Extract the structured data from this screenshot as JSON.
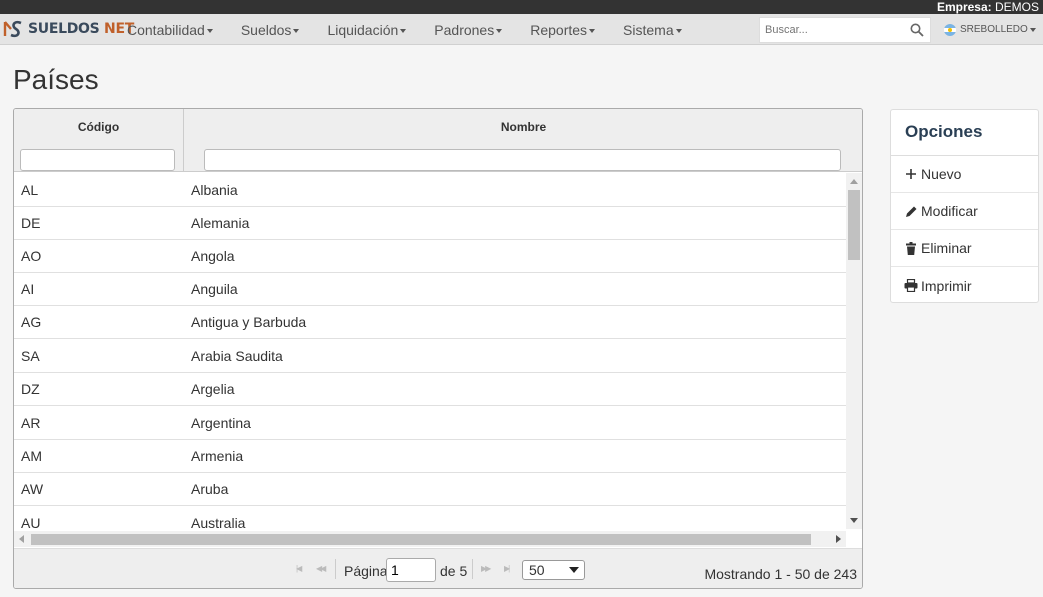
{
  "topbar": {
    "company_label": "Empresa:",
    "company_name": "DEMOS"
  },
  "brand": {
    "name_part1": "SUELDOS",
    "name_part2": "NET"
  },
  "menu": [
    {
      "label": "Contabilidad"
    },
    {
      "label": "Sueldos"
    },
    {
      "label": "Liquidación"
    },
    {
      "label": "Padrones"
    },
    {
      "label": "Reportes"
    },
    {
      "label": "Sistema"
    }
  ],
  "search": {
    "placeholder": "Buscar..."
  },
  "user": {
    "name": "SREBOLLEDO"
  },
  "page": {
    "title": "Países"
  },
  "grid": {
    "columns": {
      "code": "Código",
      "name": "Nombre"
    },
    "rows": [
      {
        "code": "AL",
        "name": "Albania"
      },
      {
        "code": "DE",
        "name": "Alemania"
      },
      {
        "code": "AO",
        "name": "Angola"
      },
      {
        "code": "AI",
        "name": "Anguila"
      },
      {
        "code": "AG",
        "name": "Antigua y Barbuda"
      },
      {
        "code": "SA",
        "name": "Arabia Saudita"
      },
      {
        "code": "DZ",
        "name": "Argelia"
      },
      {
        "code": "AR",
        "name": "Argentina"
      },
      {
        "code": "AM",
        "name": "Armenia"
      },
      {
        "code": "AW",
        "name": "Aruba"
      },
      {
        "code": "AU",
        "name": "Australia"
      }
    ]
  },
  "pager": {
    "page_label": "Página",
    "page_value": "1",
    "of_label": "de 5",
    "page_size": "50",
    "info": "Mostrando 1 - 50 de 243"
  },
  "options": {
    "title": "Opciones",
    "new_label": "Nuevo",
    "edit_label": "Modificar",
    "delete_label": "Eliminar",
    "print_label": "Imprimir"
  }
}
